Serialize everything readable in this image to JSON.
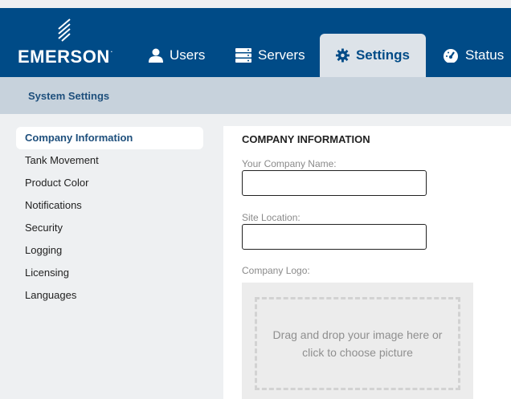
{
  "brand": {
    "name": "EMERSON",
    "trademark": "."
  },
  "nav": {
    "tabs": [
      {
        "label": "Users",
        "icon": "user-icon"
      },
      {
        "label": "Servers",
        "icon": "server-icon"
      },
      {
        "label": "Settings",
        "icon": "gear-icon",
        "active": true
      },
      {
        "label": "Status",
        "icon": "gauge-icon"
      }
    ]
  },
  "subheader": {
    "title": "System Settings"
  },
  "sidebar": {
    "items": [
      {
        "label": "Company Information",
        "active": true
      },
      {
        "label": "Tank Movement"
      },
      {
        "label": "Product Color"
      },
      {
        "label": "Notifications"
      },
      {
        "label": "Security"
      },
      {
        "label": "Logging"
      },
      {
        "label": "Licensing"
      },
      {
        "label": "Languages"
      }
    ]
  },
  "company": {
    "title": "COMPANY INFORMATION",
    "name_label": "Your Company Name:",
    "name_value": "",
    "site_label": "Site Location:",
    "site_value": "",
    "logo_label": "Company Logo:",
    "dropzone_text": "Drag and drop your image here or click to choose picture"
  },
  "colors": {
    "brand_navy": "#004b87",
    "subbar": "#c7d2dc",
    "page_bg": "#eef0f2"
  }
}
